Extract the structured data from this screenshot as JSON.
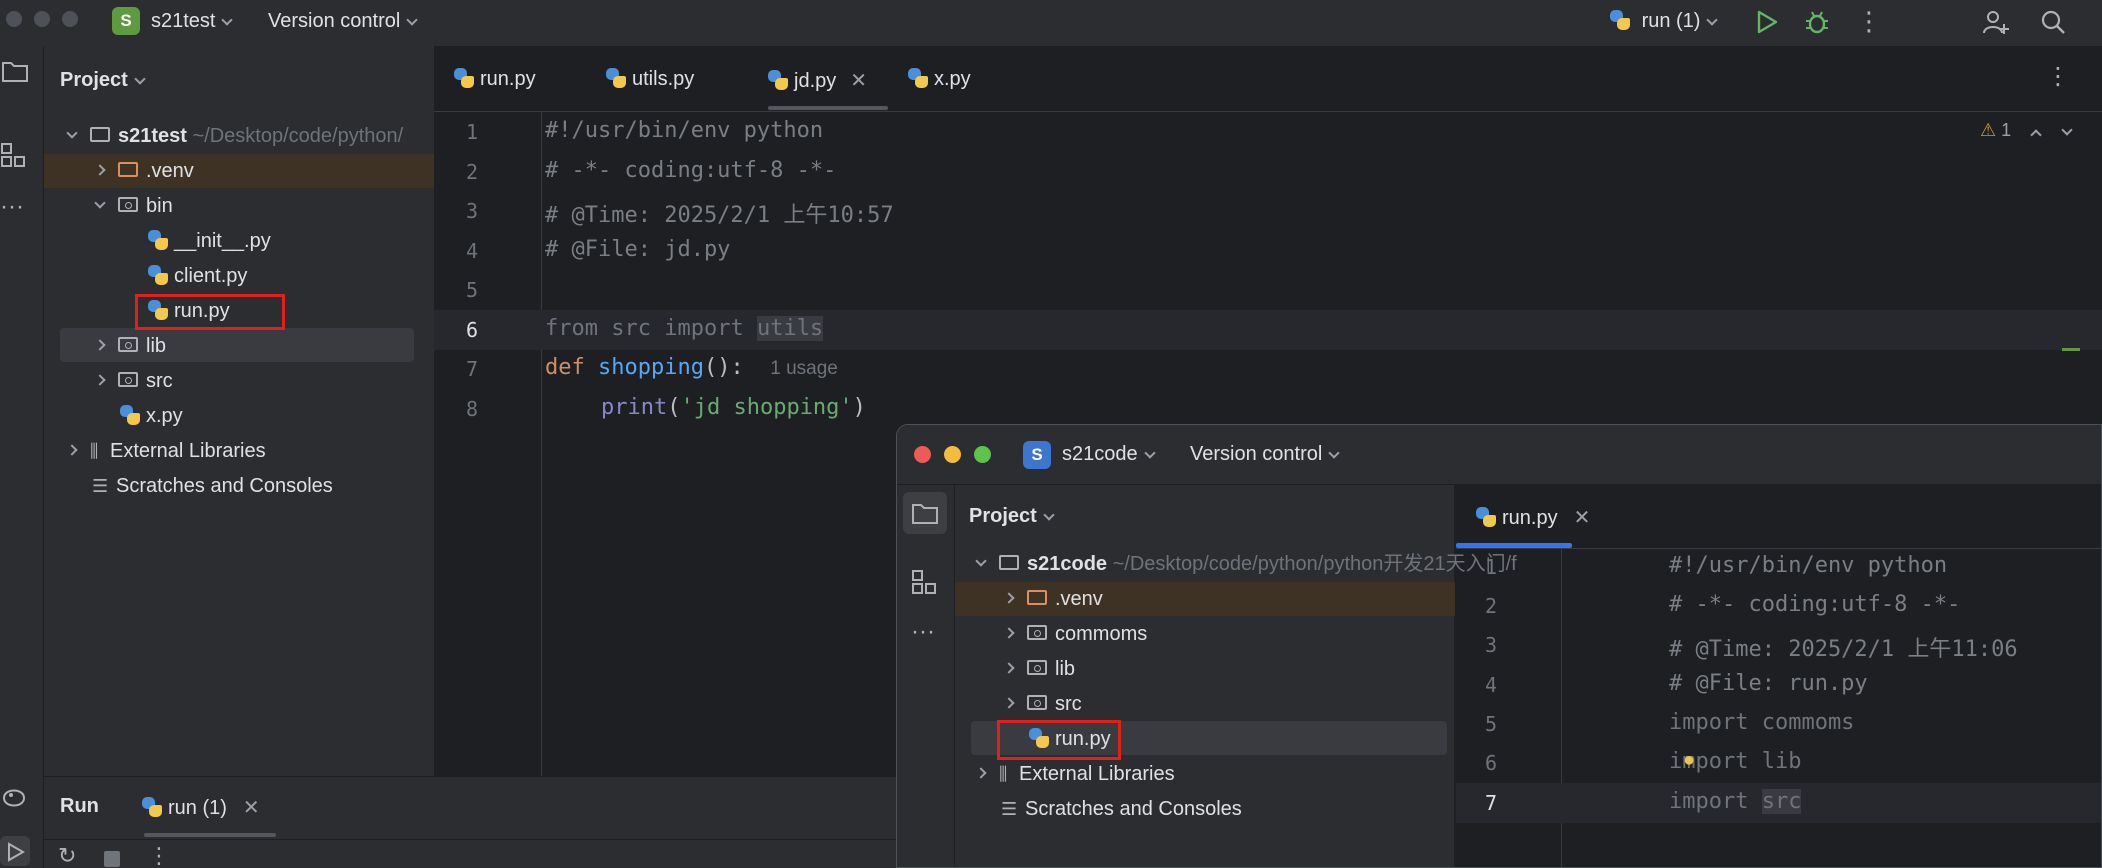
{
  "main_window": {
    "project_name": "s21test",
    "project_badge": "S",
    "version_control": "Version control",
    "run_config": "run (1)",
    "project_panel": {
      "title": "Project",
      "root": {
        "name": "s21test",
        "path": "~/Desktop/code/python/"
      },
      "items": [
        {
          "name": ".venv"
        },
        {
          "name": "bin"
        },
        {
          "name": "__init__.py"
        },
        {
          "name": "client.py"
        },
        {
          "name": "run.py"
        },
        {
          "name": "lib"
        },
        {
          "name": "src"
        },
        {
          "name": "x.py"
        },
        {
          "name": "External Libraries"
        },
        {
          "name": "Scratches and Consoles"
        }
      ]
    },
    "tabs": [
      "run.py",
      "utils.py",
      "jd.py",
      "x.py"
    ],
    "inspection": {
      "count": "1"
    },
    "code": {
      "line_numbers": [
        "1",
        "2",
        "3",
        "4",
        "5",
        "6",
        "7",
        "8"
      ],
      "l1": "#!/usr/bin/env python",
      "l2": "# -*- coding:utf-8 -*-",
      "l3": "# @Time: 2025/2/1 上午10:57",
      "l4": "# @File: jd.py",
      "l6_from": "from",
      "l6_src": " src ",
      "l6_import": "import",
      "l6_utils": "utils",
      "l7_def": "def",
      "l7_fn": "shopping",
      "l7_rest": "():",
      "l7_hint": "1 usage",
      "l8_print": "print",
      "l8_open": "(",
      "l8_str": "'jd shopping'",
      "l8_close": ")"
    },
    "run_panel": {
      "title": "Run",
      "tab": "run (1)"
    }
  },
  "second_window": {
    "project_name": "s21code",
    "project_badge": "S",
    "version_control": "Version control",
    "project_panel": {
      "title": "Project",
      "root": {
        "name": "s21code",
        "path": "~/Desktop/code/python/python开发21天入门/f"
      },
      "items": [
        {
          "name": ".venv"
        },
        {
          "name": "commoms"
        },
        {
          "name": "lib"
        },
        {
          "name": "src"
        },
        {
          "name": "run.py"
        },
        {
          "name": "External Libraries"
        },
        {
          "name": "Scratches and Consoles"
        }
      ]
    },
    "tab": "run.py",
    "code": {
      "line_numbers": [
        "1",
        "2",
        "3",
        "4",
        "5",
        "6",
        "7"
      ],
      "l1": "#!/usr/bin/env python",
      "l2": "# -*- coding:utf-8 -*-",
      "l3": "# @Time: 2025/2/1 上午11:06",
      "l4": "# @File: run.py",
      "l5": "import commoms",
      "l6": "import lib",
      "l7_import": "import ",
      "l7_src": "src"
    }
  },
  "colors": {
    "highlight": "#e0201b",
    "accent": "#3574f0",
    "project_badge_1": "#5e9a3e",
    "project_badge_2": "#3574f0"
  }
}
